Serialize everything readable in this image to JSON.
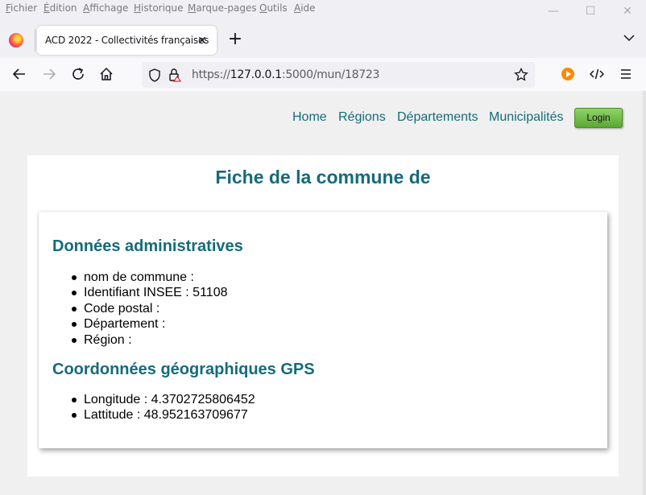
{
  "menubar": {
    "items": [
      "Fichier",
      "Édition",
      "Affichage",
      "Historique",
      "Marque-pages",
      "Outils",
      "Aide"
    ]
  },
  "window_controls": {
    "minimize": "—",
    "maximize": "☐",
    "close": "✕"
  },
  "tab": {
    "title": "ACD 2022 - Collectivités françaises",
    "close": "✕"
  },
  "new_tab": "+",
  "url": {
    "scheme": "https://",
    "host": "127.0.0.1",
    "rest": ":5000/mun/18723"
  },
  "site_nav": {
    "home": "Home",
    "regions": "Régions",
    "departements": "Départements",
    "municipalites": "Municipalités",
    "login": "Login"
  },
  "page": {
    "title": "Fiche de la commune de",
    "admin_section": {
      "title": "Données administratives",
      "items": [
        "nom de commune :",
        "Identifiant INSEE : 51108",
        "Code postal :",
        "Département :",
        "Région :"
      ]
    },
    "gps_section": {
      "title": "Coordonnées géographiques GPS",
      "items": [
        "Longitude : 4.3702725806452",
        "Lattitude : 48.952163709677"
      ]
    }
  },
  "colors": {
    "accent": "#156b7a",
    "login_button": "#6fbe45",
    "panel_bg": "#ffffff",
    "page_bg": "#f0f0f0"
  },
  "icons": [
    "firefox-icon",
    "back-icon",
    "forward-icon",
    "reload-icon",
    "home-icon",
    "shield-icon",
    "lock-icon",
    "star-icon",
    "media-icon",
    "devtools-icon",
    "hamburger-menu-icon",
    "chevron-down-icon"
  ]
}
